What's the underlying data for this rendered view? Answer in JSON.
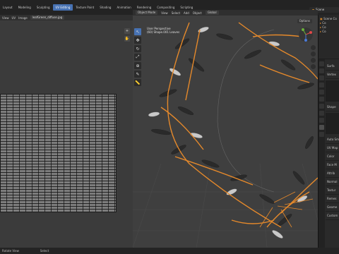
{
  "menu": {
    "items": [
      {
        "label": "Layout"
      },
      {
        "label": "Modeling"
      },
      {
        "label": "Sculpting"
      },
      {
        "label": "UV Editing",
        "active": true
      },
      {
        "label": "Texture Paint"
      },
      {
        "label": "Shading"
      },
      {
        "label": "Animation"
      },
      {
        "label": "Rendering"
      },
      {
        "label": "Compositing"
      },
      {
        "label": "Scripting"
      }
    ],
    "scene_label": "Scene"
  },
  "uv_editor": {
    "image_name": "leafGreen_diffuse.jpg",
    "header_items": [
      "View",
      "UV",
      "Image"
    ]
  },
  "viewport": {
    "mode": "Object Mode",
    "header_menus": [
      "View",
      "Select",
      "Add",
      "Object"
    ],
    "orientation": "Global",
    "options_label": "Options",
    "info_line1": "User Perspective",
    "info_line2": "(60) Shape.001 Leaves"
  },
  "outliner": {
    "rows": [
      "Scene Co",
      "Co",
      "Co",
      "Co"
    ]
  },
  "properties": {
    "rows": [
      "Surfa",
      "Vertex",
      "Shape",
      "Auto Sm",
      "UV Map",
      "Color",
      "Face M",
      "Attrib",
      "Normal",
      "Textur",
      "Remes",
      "Geome",
      "Custom"
    ]
  },
  "status": {
    "left": "Rotate View",
    "right": "Select"
  },
  "colors": {
    "accent": "#4772b3",
    "selection_orange": "#e5892b",
    "viewport_bg": "#3f3f3f"
  },
  "icons": [
    "cursor-icon",
    "move-icon",
    "rotate-icon",
    "scale-icon",
    "transform-icon",
    "annotate-icon",
    "measure-icon"
  ]
}
